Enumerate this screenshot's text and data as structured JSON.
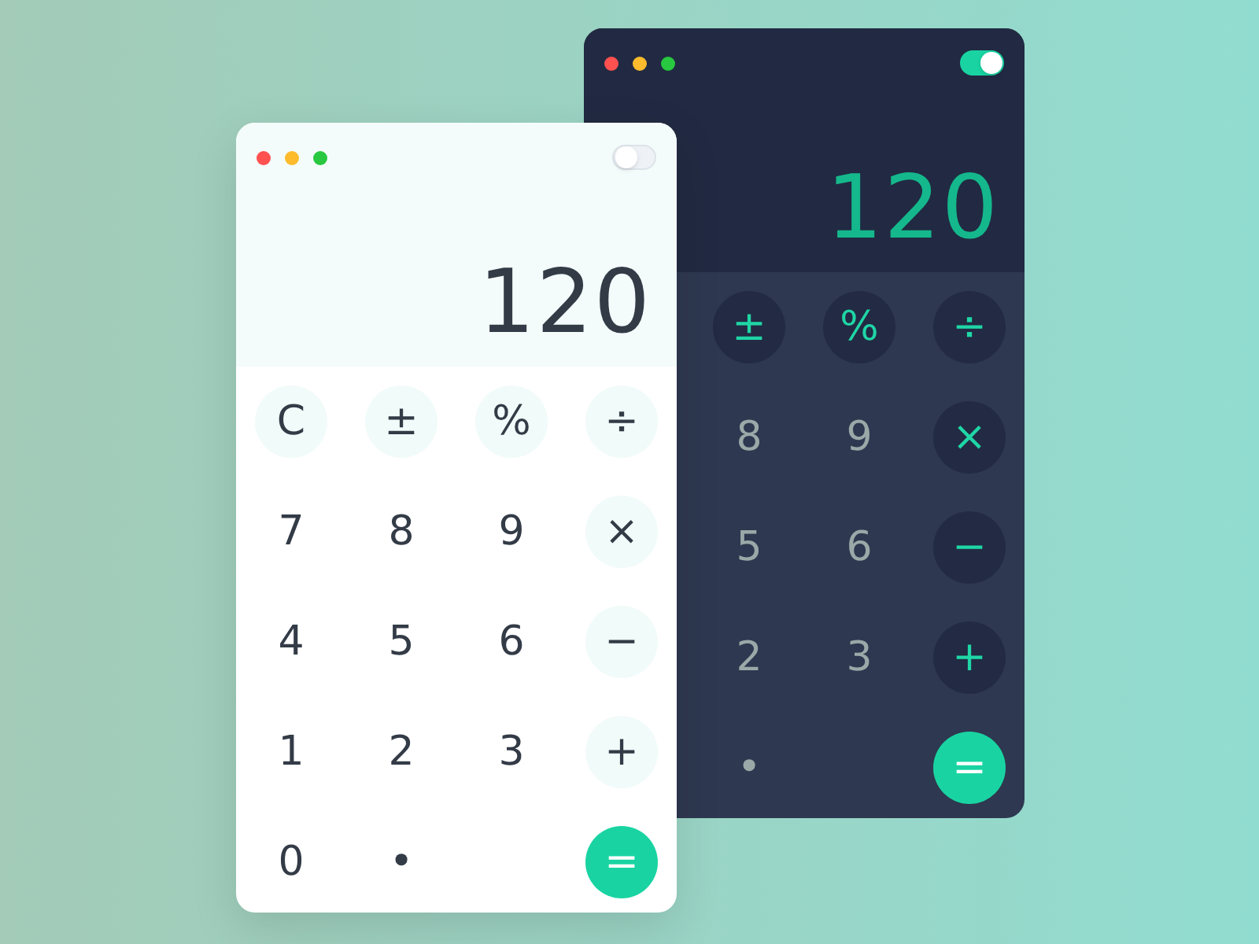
{
  "windows": [
    {
      "kind": "dark",
      "toggle_on": true,
      "display": "120",
      "keys": [
        {
          "label": "±",
          "kind": "function"
        },
        {
          "label": "%",
          "kind": "function"
        },
        {
          "label": "÷",
          "kind": "operator"
        },
        {
          "label": "8",
          "kind": "digit"
        },
        {
          "label": "9",
          "kind": "digit"
        },
        {
          "label": "×",
          "kind": "operator"
        },
        {
          "label": "5",
          "kind": "digit"
        },
        {
          "label": "6",
          "kind": "digit"
        },
        {
          "label": "−",
          "kind": "operator"
        },
        {
          "label": "2",
          "kind": "digit"
        },
        {
          "label": "3",
          "kind": "digit"
        },
        {
          "label": "+",
          "kind": "operator"
        },
        {
          "label": "•",
          "kind": "digit"
        },
        {
          "label": "=",
          "kind": "equals"
        }
      ]
    },
    {
      "kind": "light",
      "toggle_on": false,
      "display": "120",
      "keys": [
        {
          "label": "C",
          "kind": "function"
        },
        {
          "label": "±",
          "kind": "function"
        },
        {
          "label": "%",
          "kind": "function"
        },
        {
          "label": "÷",
          "kind": "operator"
        },
        {
          "label": "7",
          "kind": "digit"
        },
        {
          "label": "8",
          "kind": "digit"
        },
        {
          "label": "9",
          "kind": "digit"
        },
        {
          "label": "×",
          "kind": "operator"
        },
        {
          "label": "4",
          "kind": "digit"
        },
        {
          "label": "5",
          "kind": "digit"
        },
        {
          "label": "6",
          "kind": "digit"
        },
        {
          "label": "−",
          "kind": "operator"
        },
        {
          "label": "1",
          "kind": "digit"
        },
        {
          "label": "2",
          "kind": "digit"
        },
        {
          "label": "3",
          "kind": "digit"
        },
        {
          "label": "+",
          "kind": "operator"
        },
        {
          "label": "0",
          "kind": "digit"
        },
        {
          "label": "•",
          "kind": "digit"
        },
        {
          "label": "=",
          "kind": "equals"
        }
      ]
    }
  ]
}
